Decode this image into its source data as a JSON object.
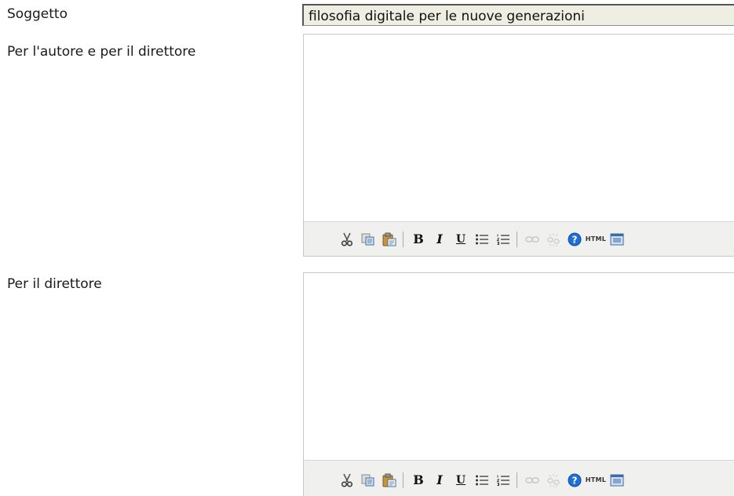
{
  "form": {
    "subject_label": "Soggetto",
    "subject_value": "filosofia digitale per le nuove generazioni",
    "author_label": "Per l'autore e per il direttore",
    "author_content": "",
    "director_label": "Per il direttore",
    "director_content": ""
  },
  "toolbar": {
    "icons": [
      "cut-icon",
      "copy-icon",
      "paste-icon",
      "bold-icon",
      "italic-icon",
      "underline-icon",
      "bullet-list-icon",
      "numbered-list-icon",
      "link-icon",
      "unlink-icon",
      "help-icon",
      "html-source-icon",
      "fullscreen-icon"
    ],
    "bold_glyph": "B",
    "italic_glyph": "I",
    "underline_glyph": "U",
    "html_glyph": "HTML"
  },
  "colors": {
    "input_background": "#eeeee2",
    "toolbar_background": "#f0f0ee",
    "help_icon_blue": "#1f6fd6"
  }
}
